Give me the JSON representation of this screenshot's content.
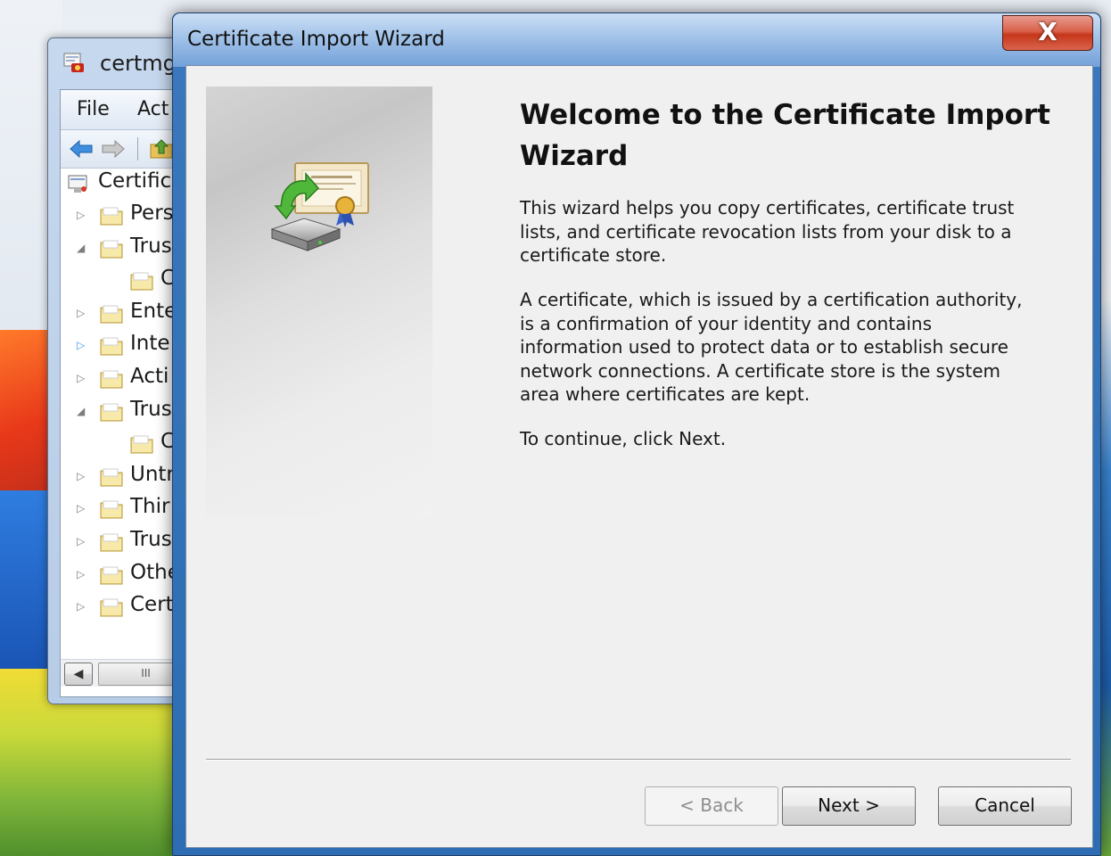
{
  "background_window": {
    "title": "certmg",
    "menu": [
      "File",
      "Act"
    ],
    "tree_root": "Certific",
    "tree_items": [
      {
        "label": "Pers",
        "arrow": "▷",
        "sub": false
      },
      {
        "label": "Trus",
        "arrow": "◢",
        "sub": false
      },
      {
        "label": "C",
        "arrow": "",
        "sub": true
      },
      {
        "label": "Ente",
        "arrow": "▷",
        "sub": false
      },
      {
        "label": "Inte",
        "arrow": "▷",
        "sub": false
      },
      {
        "label": "Acti",
        "arrow": "▷",
        "sub": false
      },
      {
        "label": "Trus",
        "arrow": "◢",
        "sub": false
      },
      {
        "label": "C",
        "arrow": "",
        "sub": true
      },
      {
        "label": "Untr",
        "arrow": "▷",
        "sub": false
      },
      {
        "label": "Thir",
        "arrow": "▷",
        "sub": false
      },
      {
        "label": "Trus",
        "arrow": "▷",
        "sub": false
      },
      {
        "label": "Othe",
        "arrow": "▷",
        "sub": false
      },
      {
        "label": "Cert",
        "arrow": "▷",
        "sub": false
      }
    ],
    "scroll_left": "◀",
    "scroll_thumb": "III"
  },
  "wizard": {
    "title": "Certificate Import Wizard",
    "close_label": "X",
    "heading": "Welcome to the Certificate Import Wizard",
    "paragraph1": "This wizard helps you copy certificates, certificate trust lists, and certificate revocation lists from your disk to a certificate store.",
    "paragraph2": "A certificate, which is issued by a certification authority, is a confirmation of your identity and contains information used to protect data or to establish secure network connections. A certificate store is the system area where certificates are kept.",
    "paragraph3": "To continue, click Next.",
    "buttons": {
      "back": "< Back",
      "next": "Next >",
      "cancel": "Cancel"
    }
  }
}
